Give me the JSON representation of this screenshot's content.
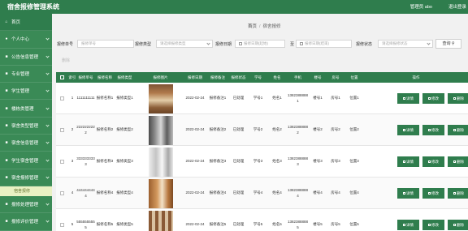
{
  "app": {
    "title": "宿舍报修管理系统",
    "user": "管理员 abo",
    "logout": "退出登录"
  },
  "sidebar": {
    "items": [
      {
        "label": "首页",
        "icon": "home-icon",
        "glyph": "⌂"
      },
      {
        "label": "个人中心",
        "icon": "user-icon",
        "glyph": "●"
      },
      {
        "label": "公告信息管理",
        "icon": "notice-icon",
        "glyph": "■"
      },
      {
        "label": "专业管理",
        "icon": "book-icon",
        "glyph": "■"
      },
      {
        "label": "学生管理",
        "icon": "student-icon",
        "glyph": "■"
      },
      {
        "label": "楼栋类管理",
        "icon": "building-icon",
        "glyph": "■"
      },
      {
        "label": "宿舍类型管理",
        "icon": "dorm-type-icon",
        "glyph": "■"
      },
      {
        "label": "宿舍信息管理",
        "icon": "dorm-info-icon",
        "glyph": "■"
      },
      {
        "label": "学生宿舍管理",
        "icon": "student-dorm-icon",
        "glyph": "■"
      },
      {
        "label": "宿舍报修管理",
        "icon": "repair-icon",
        "glyph": "■"
      }
    ],
    "sub_item": "宿舍报修",
    "after_items": [
      {
        "label": "报修处理管理",
        "icon": "process-icon",
        "glyph": "■"
      },
      {
        "label": "报修评价管理",
        "icon": "evaluate-icon",
        "glyph": "■"
      }
    ]
  },
  "breadcrumb": {
    "home": "首页",
    "sep": "/",
    "current": "宿舍报修"
  },
  "search": {
    "fields": [
      {
        "label": "报修单号",
        "placeholder": "报修单号"
      },
      {
        "label": "报修类型",
        "placeholder": "请选择报修类型"
      },
      {
        "label": "报修日期",
        "placeholder": "报修日期(起始)"
      },
      {
        "label": "至",
        "placeholder": "报修日期(结束)"
      },
      {
        "label": "报修状态",
        "placeholder": "请选择报修状态"
      }
    ],
    "button": "查询",
    "delete": "删除"
  },
  "table": {
    "headers": [
      "索引",
      "报修单号",
      "报修名称",
      "报修类型",
      "报修图片",
      "报修日期",
      "报修备注",
      "报修状态",
      "学号",
      "姓名",
      "手机",
      "楼号",
      "房号",
      "位置",
      "操作"
    ],
    "actions": {
      "detail": "详情",
      "edit": "修改",
      "delete": "删除"
    },
    "rows": [
      {
        "index": "1",
        "no": "1111111111",
        "name": "报修名称1",
        "type": "报修类型1",
        "img": "t-wood",
        "date": "2022-02-24",
        "remark": "报修备注1",
        "status": "已处理",
        "sid": "学号1",
        "sname": "姓名1",
        "phone": "13823888881",
        "bld": "楼号1",
        "room": "房号1",
        "pos": "位置1"
      },
      {
        "index": "2",
        "no": "2222222222",
        "name": "报修名称2",
        "type": "报修类型2",
        "img": "t-dark",
        "date": "2022-02-24",
        "remark": "报修备注2",
        "status": "已处理",
        "sid": "学号2",
        "sname": "姓名2",
        "phone": "13823888882",
        "bld": "楼号2",
        "room": "房号2",
        "pos": "位置2"
      },
      {
        "index": "3",
        "no": "3333333333",
        "name": "报修名称3",
        "type": "报修类型3",
        "img": "t-light",
        "date": "2022-02-24",
        "remark": "报修备注3",
        "status": "已处理",
        "sid": "学号3",
        "sname": "姓名3",
        "phone": "13823888883",
        "bld": "楼号3",
        "room": "房号3",
        "pos": "位置3"
      },
      {
        "index": "4",
        "no": "4444444444",
        "name": "报修名称4",
        "type": "报修类型4",
        "img": "t-wood2",
        "date": "2022-02-24",
        "remark": "报修备注4",
        "status": "已处理",
        "sid": "学号4",
        "sname": "姓名4",
        "phone": "13823888884",
        "bld": "楼号4",
        "room": "房号4",
        "pos": "位置4"
      },
      {
        "index": "5",
        "no": "5555555555",
        "name": "报修名称5",
        "type": "报修类型5",
        "img": "t-stripe",
        "date": "2022-02-24",
        "remark": "报修备注5",
        "status": "已处理",
        "sid": "学号5",
        "sname": "姓名5",
        "phone": "13823888885",
        "bld": "楼号5",
        "room": "房号5",
        "pos": "位置5"
      }
    ]
  }
}
